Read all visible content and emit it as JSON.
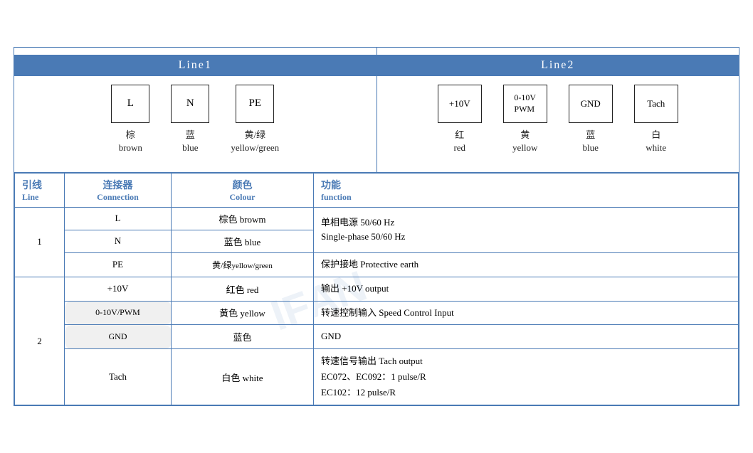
{
  "header": {
    "line1_label": "Line1",
    "line2_label": "Line2"
  },
  "line1_connectors": [
    {
      "symbol": "L",
      "cn": "棕",
      "en": "brown"
    },
    {
      "symbol": "N",
      "cn": "蓝",
      "en": "blue"
    },
    {
      "symbol": "PE",
      "cn": "黄/绿",
      "en": "yellow/green"
    }
  ],
  "line2_connectors": [
    {
      "symbol": "+10V",
      "cn": "红",
      "en": "red"
    },
    {
      "symbol": "0-10V\nPWM",
      "cn": "黄",
      "en": "yellow"
    },
    {
      "symbol": "GND",
      "cn": "蓝",
      "en": "blue"
    },
    {
      "symbol": "Tach",
      "cn": "白",
      "en": "white"
    }
  ],
  "table": {
    "headers": {
      "line_cn": "引线",
      "line_en": "Line",
      "connection_cn": "连接器",
      "connection_en": "Connection",
      "colour_cn": "颜色",
      "colour_en": "Colour",
      "function_cn": "功能",
      "function_en": "function"
    },
    "rows": [
      {
        "line": "1",
        "line_rowspan": 3,
        "connection": "L",
        "colour": "棕色 browm",
        "function": "单相电源 50/60 Hz\nSingle-phase 50/60 Hz",
        "function_rowspan": 2
      },
      {
        "line": "",
        "connection": "N",
        "colour": "蓝色 blue",
        "function": ""
      },
      {
        "line": "",
        "connection": "PE",
        "colour": "黄/绿yellow/green",
        "function": "保护接地 Protective earth"
      },
      {
        "line": "2",
        "line_rowspan": 4,
        "connection": "+10V",
        "colour": "红色 red",
        "function": "输出 +10V output"
      },
      {
        "line": "",
        "connection": "0-10V/PWM",
        "colour": "黄色 yellow",
        "function": "转速控制输入 Speed Control Input"
      },
      {
        "line": "",
        "connection": "GND",
        "colour": "蓝色",
        "function": "GND"
      },
      {
        "line": "",
        "connection": "Tach",
        "colour": "白色 white",
        "function": "转速信号输出 Tach output\nEC072、EC092：1 pulse/R\nEC102：12 pulse/R"
      }
    ]
  }
}
